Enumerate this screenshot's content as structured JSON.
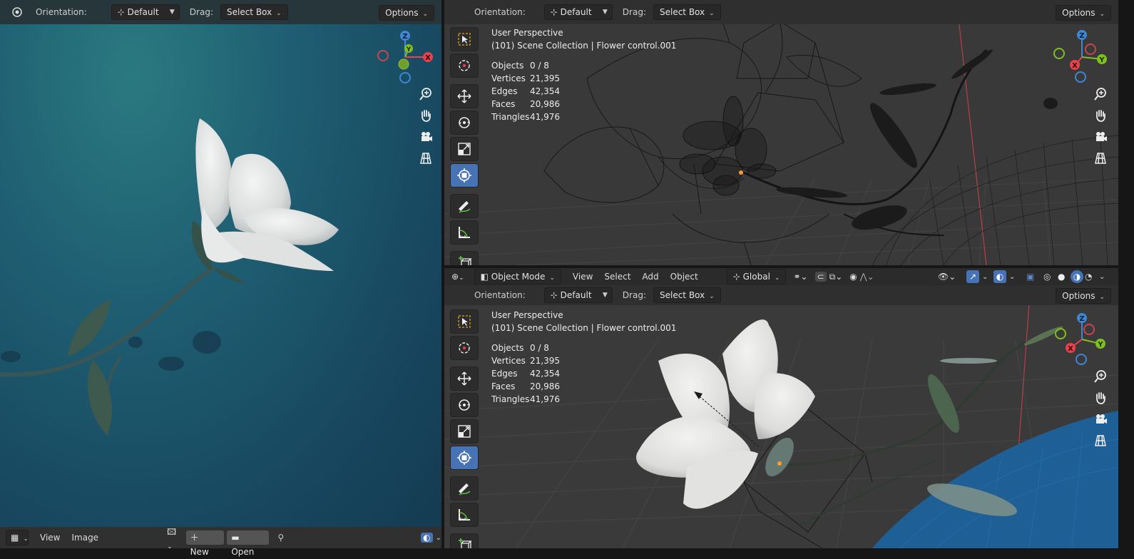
{
  "left_view": {
    "orientation_label": "Orientation:",
    "orientation_value": "Default",
    "drag_label": "Drag:",
    "drag_value": "Select Box",
    "options_label": "Options"
  },
  "image_editor": {
    "menu_view": "View",
    "menu_image": "Image",
    "new_label": "New",
    "open_label": "Open"
  },
  "top_view": {
    "orientation_label": "Orientation:",
    "orientation_value": "Default",
    "drag_label": "Drag:",
    "drag_value": "Select Box",
    "options_label": "Options",
    "perspective": "User Perspective",
    "collection": "(101) Scene Collection | Flower control.001",
    "stats": [
      {
        "label": "Objects",
        "value": "0 / 8"
      },
      {
        "label": "Vertices",
        "value": "21,395"
      },
      {
        "label": "Edges",
        "value": "42,354"
      },
      {
        "label": "Faces",
        "value": "20,986"
      },
      {
        "label": "Triangles",
        "value": "41,976"
      }
    ]
  },
  "bottom_view": {
    "mode": "Object Mode",
    "menus": [
      "View",
      "Select",
      "Add",
      "Object"
    ],
    "transform": "Global",
    "orientation_label": "Orientation:",
    "orientation_value": "Default",
    "drag_label": "Drag:",
    "drag_value": "Select Box",
    "options_label": "Options",
    "perspective": "User Perspective",
    "collection": "(101) Scene Collection | Flower control.001",
    "stats": [
      {
        "label": "Objects",
        "value": "0 / 8"
      },
      {
        "label": "Vertices",
        "value": "21,395"
      },
      {
        "label": "Edges",
        "value": "42,354"
      },
      {
        "label": "Faces",
        "value": "20,986"
      },
      {
        "label": "Triangles",
        "value": "41,976"
      }
    ]
  },
  "gizmo_axes": {
    "z": "Z",
    "y": "Y",
    "x": "X"
  },
  "colors": {
    "x_axis": "#e8424d",
    "y_axis": "#7fbf1f",
    "z_axis": "#3f86d4",
    "accent": "#4772b3"
  },
  "icons": [
    "select-box-icon",
    "cursor-icon",
    "move-icon",
    "rotate-icon",
    "scale-icon",
    "transform-icon",
    "annotate-icon",
    "measure-icon",
    "add-cube-icon",
    "zoom-icon",
    "hand-icon",
    "camera-icon",
    "grid-icon"
  ]
}
